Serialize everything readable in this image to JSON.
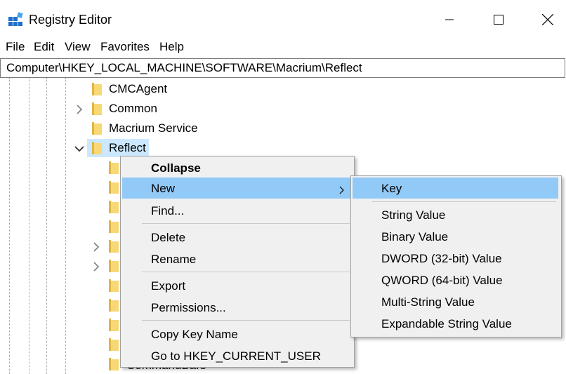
{
  "window": {
    "title": "Registry Editor"
  },
  "menubar": {
    "file": "File",
    "edit": "Edit",
    "view": "View",
    "favorites": "Favorites",
    "help": "Help"
  },
  "address": {
    "path": "Computer\\HKEY_LOCAL_MACHINE\\SOFTWARE\\Macrium\\Reflect"
  },
  "tree": {
    "cmcagent": "CMCAgent",
    "common": "Common",
    "macrium_service": "Macrium Service",
    "reflect": "Reflect",
    "partial_bottom": "CommandBars"
  },
  "context_menu": {
    "collapse": "Collapse",
    "new": "New",
    "find": "Find...",
    "delete": "Delete",
    "rename": "Rename",
    "export": "Export",
    "permissions": "Permissions...",
    "copy_key_name": "Copy Key Name",
    "goto_hkcu": "Go to HKEY_CURRENT_USER"
  },
  "submenu": {
    "key": "Key",
    "string_value": "String Value",
    "binary_value": "Binary Value",
    "dword_value": "DWORD (32-bit) Value",
    "qword_value": "QWORD (64-bit) Value",
    "multi_string_value": "Multi-String Value",
    "expandable_string_value": "Expandable String Value"
  },
  "colors": {
    "highlight": "#91c9f7",
    "selection": "#cce8ff",
    "folder": "#f8d775",
    "menu_bg": "#f0f0f0"
  }
}
